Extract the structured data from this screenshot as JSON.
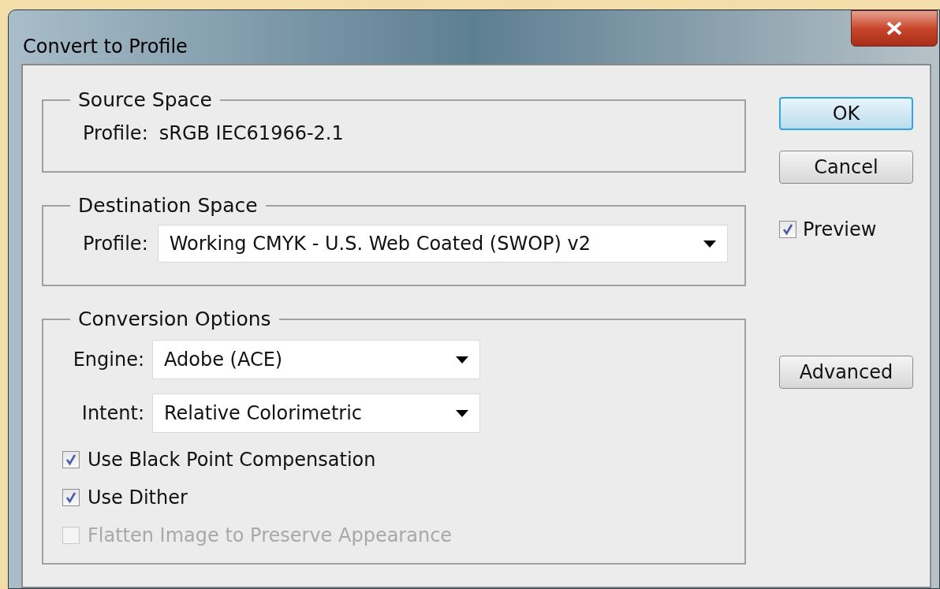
{
  "window": {
    "title": "Convert to Profile"
  },
  "source_space": {
    "title": "Source Space",
    "label": "Profile:",
    "value": "sRGB IEC61966-2.1"
  },
  "destination_space": {
    "title": "Destination Space",
    "label": "Profile:",
    "value": "Working CMYK - U.S. Web Coated (SWOP) v2"
  },
  "conversion_options": {
    "title": "Conversion Options",
    "selects": [
      {
        "label": "Engine:",
        "value": "Adobe (ACE)"
      },
      {
        "label": "Intent:",
        "value": "Relative Colorimetric"
      }
    ],
    "checkboxes": [
      {
        "label": "Use Black Point Compensation",
        "checked": true,
        "disabled": false
      },
      {
        "label": "Use Dither",
        "checked": true,
        "disabled": false
      },
      {
        "label": "Flatten Image to Preserve Appearance",
        "checked": false,
        "disabled": true
      }
    ]
  },
  "buttons": [
    {
      "label": "OK",
      "default": true
    },
    {
      "label": "Cancel",
      "default": false
    }
  ],
  "preview": {
    "label": "Preview",
    "checked": true
  },
  "advanced_button": {
    "label": "Advanced"
  }
}
